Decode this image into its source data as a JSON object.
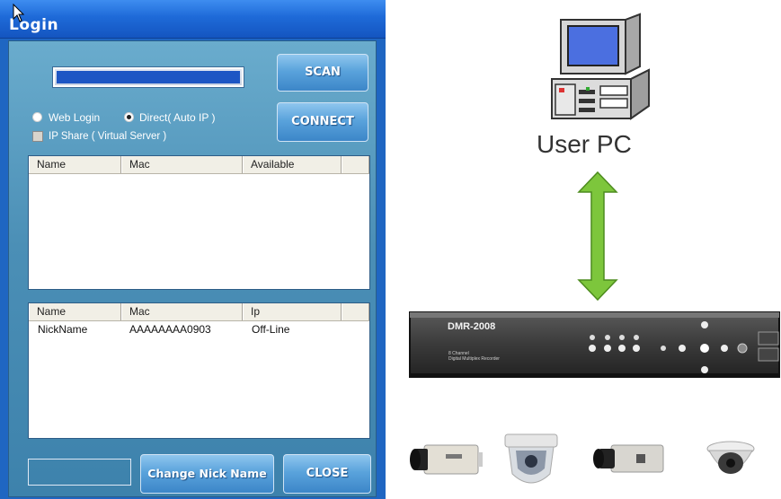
{
  "window": {
    "title": "Login"
  },
  "login": {
    "scan_label": "SCAN",
    "connect_label": "CONNECT",
    "web_login_label": "Web Login",
    "direct_label": "Direct( Auto IP )",
    "ip_share_label": "IP Share ( Virtual Server )",
    "mode_selected": "Direct( Auto IP )",
    "ip_share_checked": false,
    "scan_list": {
      "columns": [
        "Name",
        "Mac",
        "Available"
      ],
      "rows": []
    },
    "nick_list": {
      "columns": [
        "Name",
        "Mac",
        "Ip"
      ],
      "rows": [
        {
          "name": "NickName",
          "mac": "AAAAAAAA0903",
          "ip": "Off-Line"
        }
      ]
    },
    "nick_input_value": "",
    "change_nick_label": "Change Nick Name",
    "close_label": "CLOSE"
  },
  "diagram": {
    "pc_label": "User PC",
    "dvr_model": "DMR-2008",
    "dvr_sub1": "8 Channel",
    "dvr_sub2": "Digital Multiplex Recorder",
    "icons": [
      "desktop-pc-icon",
      "double-arrow-icon",
      "dvr-device-icon",
      "box-camera-icon",
      "dome-camera-icon"
    ]
  },
  "colors": {
    "titlebar": "#1e6ad8",
    "panel": "#4b8fb6",
    "button": "#5aa3dc",
    "arrow": "#7dc63c"
  }
}
